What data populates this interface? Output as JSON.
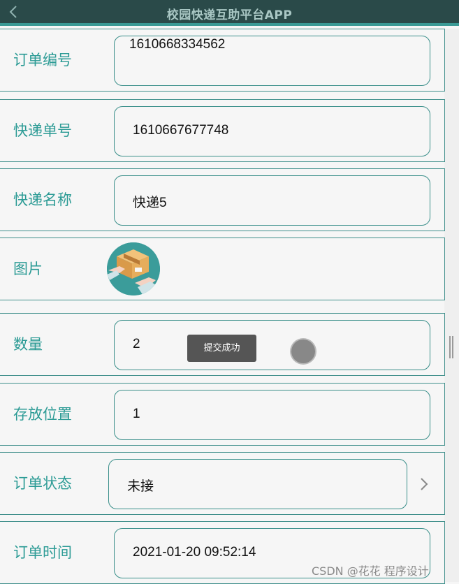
{
  "header": {
    "title": "校园快递互助平台APP",
    "back_icon": "chevron-left-icon"
  },
  "form": {
    "order_number": {
      "label": "订单编号",
      "value": "1610668334562"
    },
    "tracking_number": {
      "label": "快递单号",
      "value": "1610667677748"
    },
    "courier_name": {
      "label": "快递名称",
      "value": "快递5"
    },
    "image": {
      "label": "图片",
      "icon": "package-delivery-icon"
    },
    "quantity": {
      "label": "数量",
      "value": "2"
    },
    "storage_location": {
      "label": "存放位置",
      "value": "1"
    },
    "order_status": {
      "label": "订单状态",
      "value": "未接",
      "chevron_icon": "chevron-right-icon"
    },
    "order_time": {
      "label": "订单时间",
      "value": "2021-01-20 09:52:14"
    }
  },
  "toast": {
    "text": "提交成功"
  },
  "watermark": {
    "text": "CSDN @花花 程序设计"
  },
  "colors": {
    "header_bg": "#2a4a49",
    "accent": "#2c9b95",
    "border": "#3a8f8a",
    "toast_bg": "#555555"
  }
}
